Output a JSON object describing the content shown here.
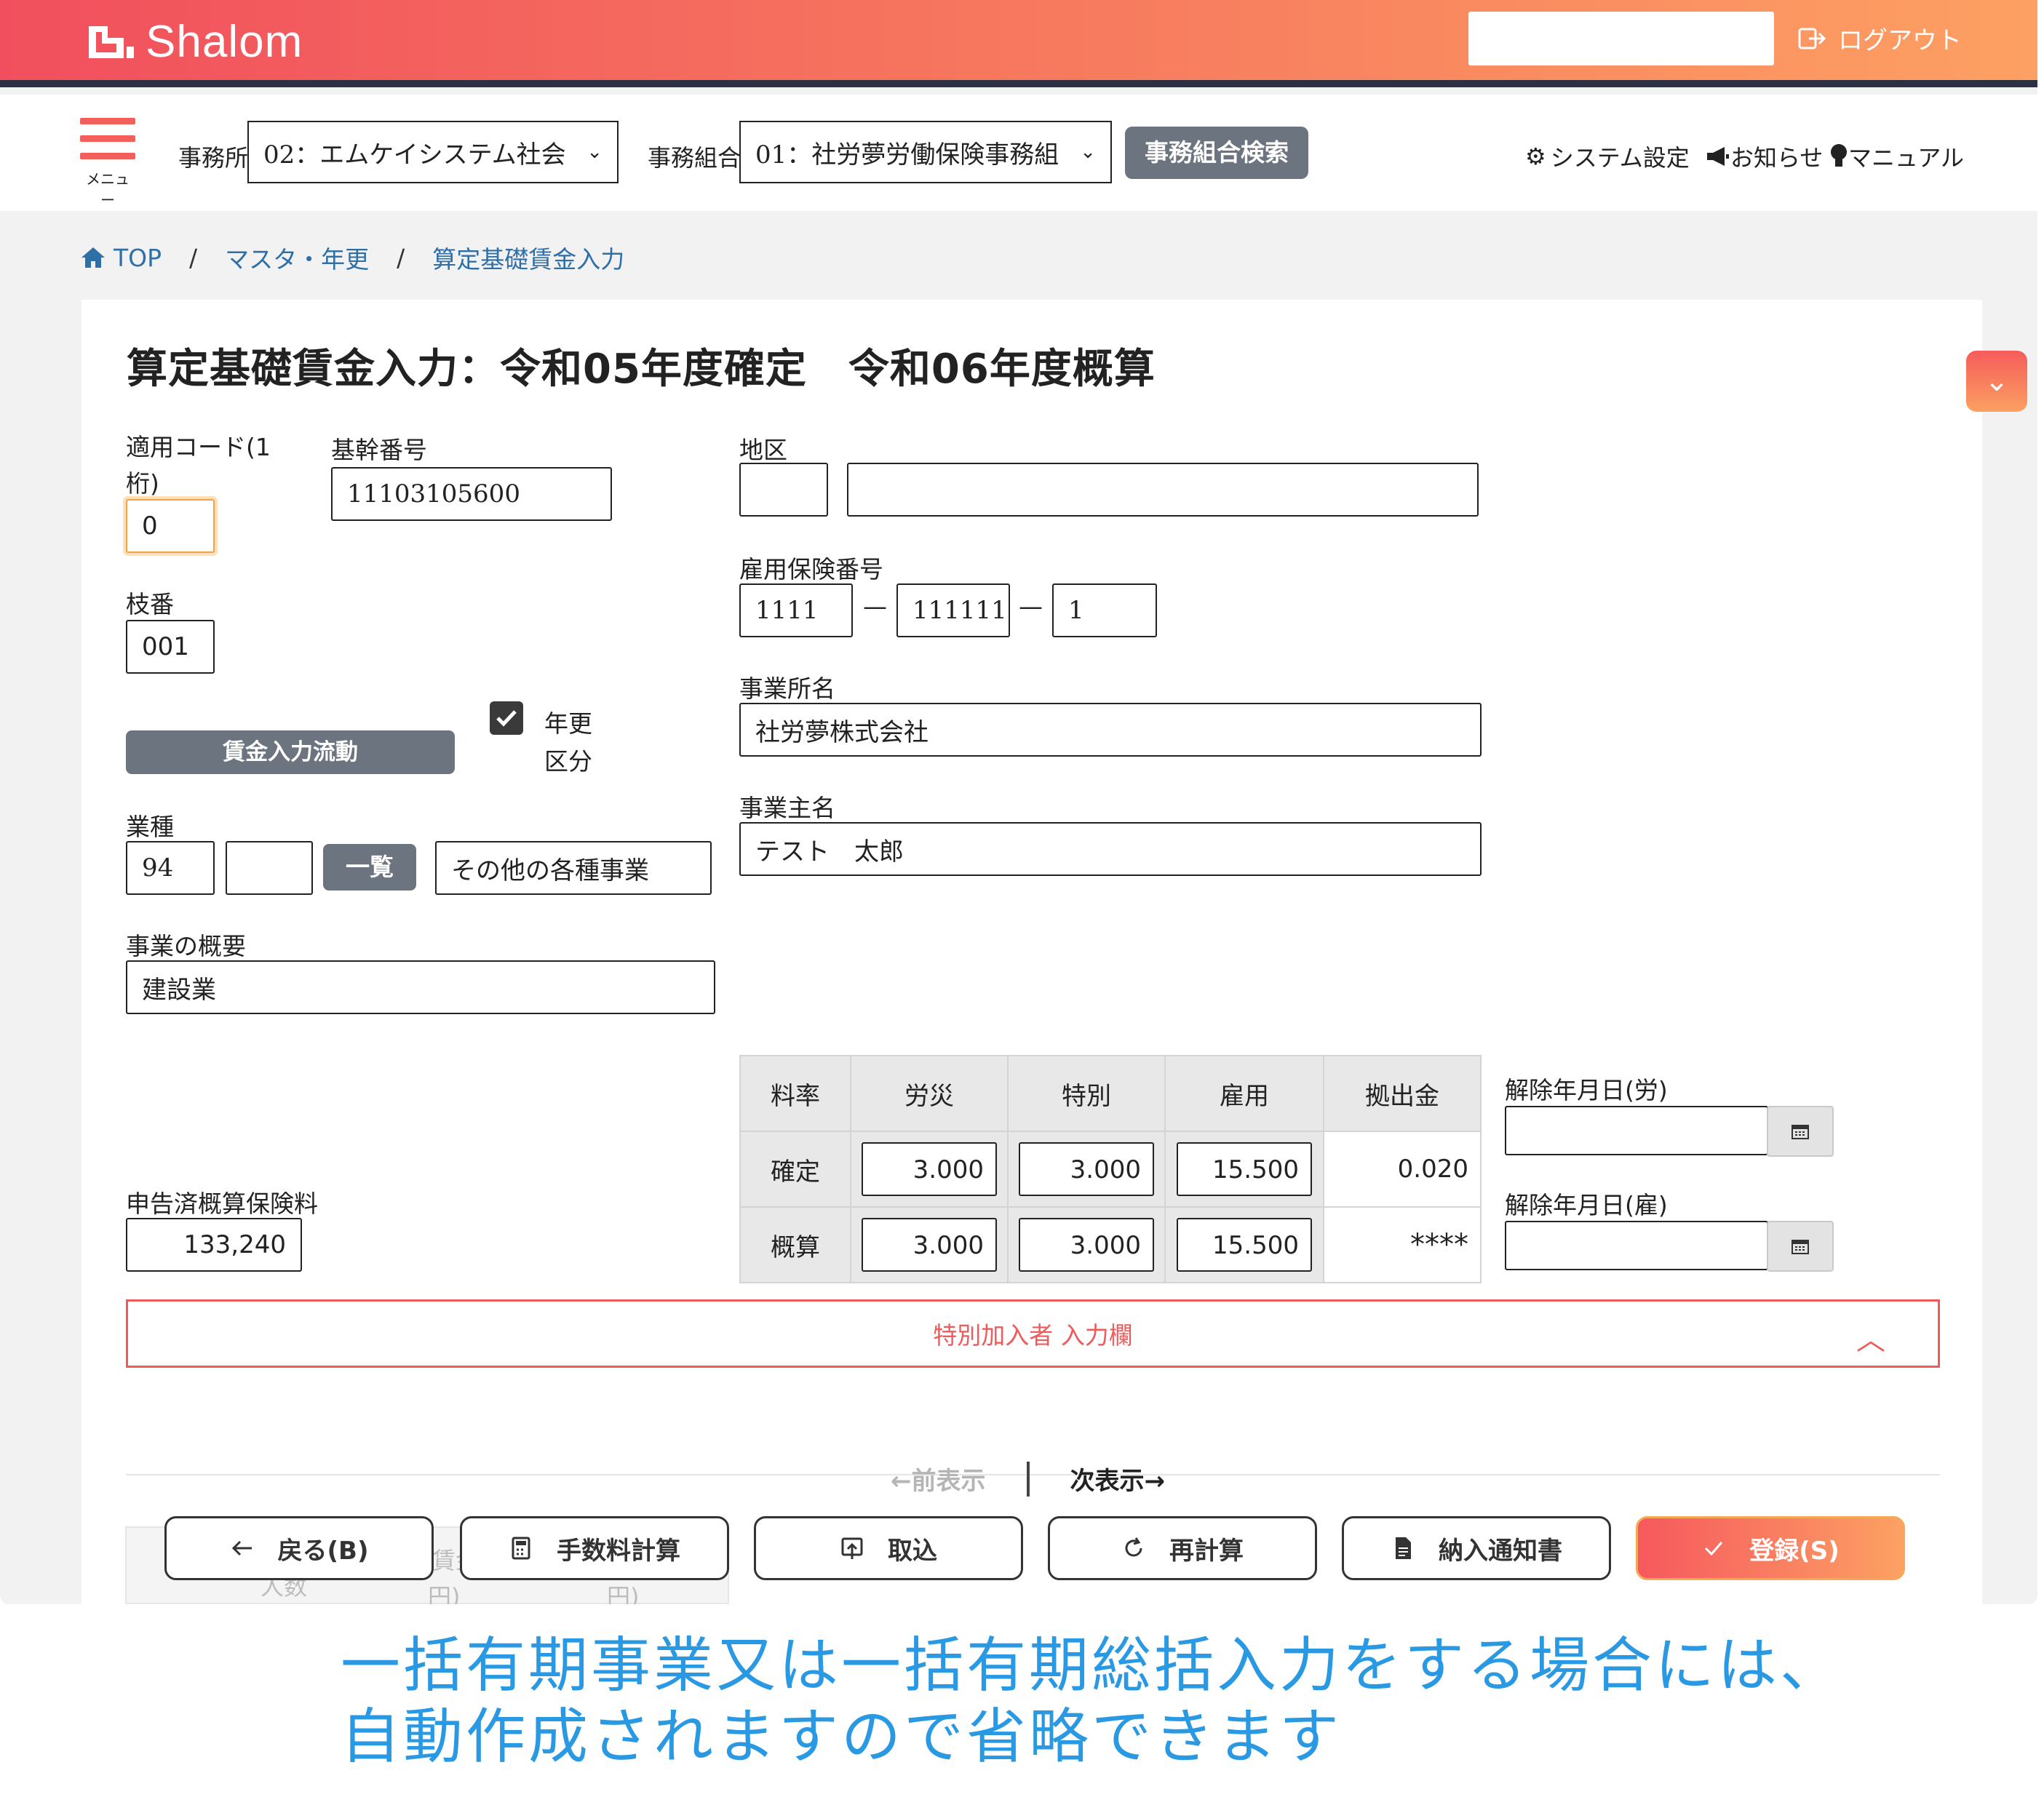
{
  "app": {
    "logo_text": "Shalom",
    "logout_label": "ログアウト",
    "top_input_value": ""
  },
  "subbar": {
    "menu_label": "メニュー",
    "office_label": "事務所",
    "office_value": "02：エムケイシステム社会",
    "union_label": "事務組合",
    "union_value": "01：社労夢労働保険事務組",
    "union_search_label": "事務組合検索",
    "system_settings": "システム設定",
    "notice": "お知らせ",
    "manual": "マニュアル"
  },
  "breadcrumb": [
    "TOP",
    "マスタ・年更",
    "算定基礎賃金入力"
  ],
  "page_title": "算定基礎賃金入力：令和05年度確定　令和06年度概算",
  "form": {
    "apply_code_label_1": "適用コード(1",
    "apply_code_label_2": "桁)",
    "apply_code": "0",
    "base_number_label": "基幹番号",
    "base_number": "11103105600",
    "branch_label": "枝番",
    "branch": "001",
    "district_label": "地区",
    "district_code": "",
    "district_name": "",
    "employment_label": "雇用保険番号",
    "employment_1": "1111",
    "employment_2": "111111",
    "employment_3": "1",
    "office_name_label": "事業所名",
    "office_name": "社労夢株式会社",
    "owner_label": "事業主名",
    "owner": "テスト　太郎",
    "wage_flow_button": "賃金入力流動",
    "nenkou_label_1": "年更",
    "nenkou_label_2": "区分",
    "nenkou_checked": true,
    "industry_label": "業種",
    "industry_code": "94",
    "industry_sub": "",
    "list_button": "一覧",
    "industry_name": "その他の各種事業",
    "business_label": "事業の概要",
    "business": "建設業",
    "declared_label": "申告済概算保険料",
    "declared_value": "133,240"
  },
  "rates": {
    "headers": [
      "料率",
      "労災",
      "特別",
      "雇用",
      "拠出金"
    ],
    "rows": [
      {
        "label": "確定",
        "rousai": "3.000",
        "tokubetsu": "3.000",
        "koyou": "15.500",
        "kyoshutsu": "0.020"
      },
      {
        "label": "概算",
        "rousai": "3.000",
        "tokubetsu": "3.000",
        "koyou": "15.500",
        "kyoshutsu": "****"
      }
    ]
  },
  "cancel": {
    "labor_label": "解除年月日(労)",
    "labor_value": "",
    "emp_label": "解除年月日(雇)",
    "emp_value": ""
  },
  "special_section": "特別加入者 入力欄",
  "pager": {
    "prev": "←前表示",
    "next": "次表示→"
  },
  "ghost_table": {
    "text_1": "賃金",
    "text_2": "人数",
    "text_3": "円)",
    "text_4": "円)"
  },
  "buttons": {
    "back": "戻る(B)",
    "fee": "手数料計算",
    "import": "取込",
    "recalc": "再計算",
    "notice_doc": "納入通知書",
    "register": "登録(S)"
  },
  "caption": {
    "line1": "一括有期事業又は一括有期総括入力をする場合には、",
    "line2": "自動作成されますので省略できます"
  },
  "colors": {
    "accent": "#f35f5a",
    "caption": "#2a99e3",
    "dark_button": "#6c7480",
    "link": "#2f6fa8"
  }
}
